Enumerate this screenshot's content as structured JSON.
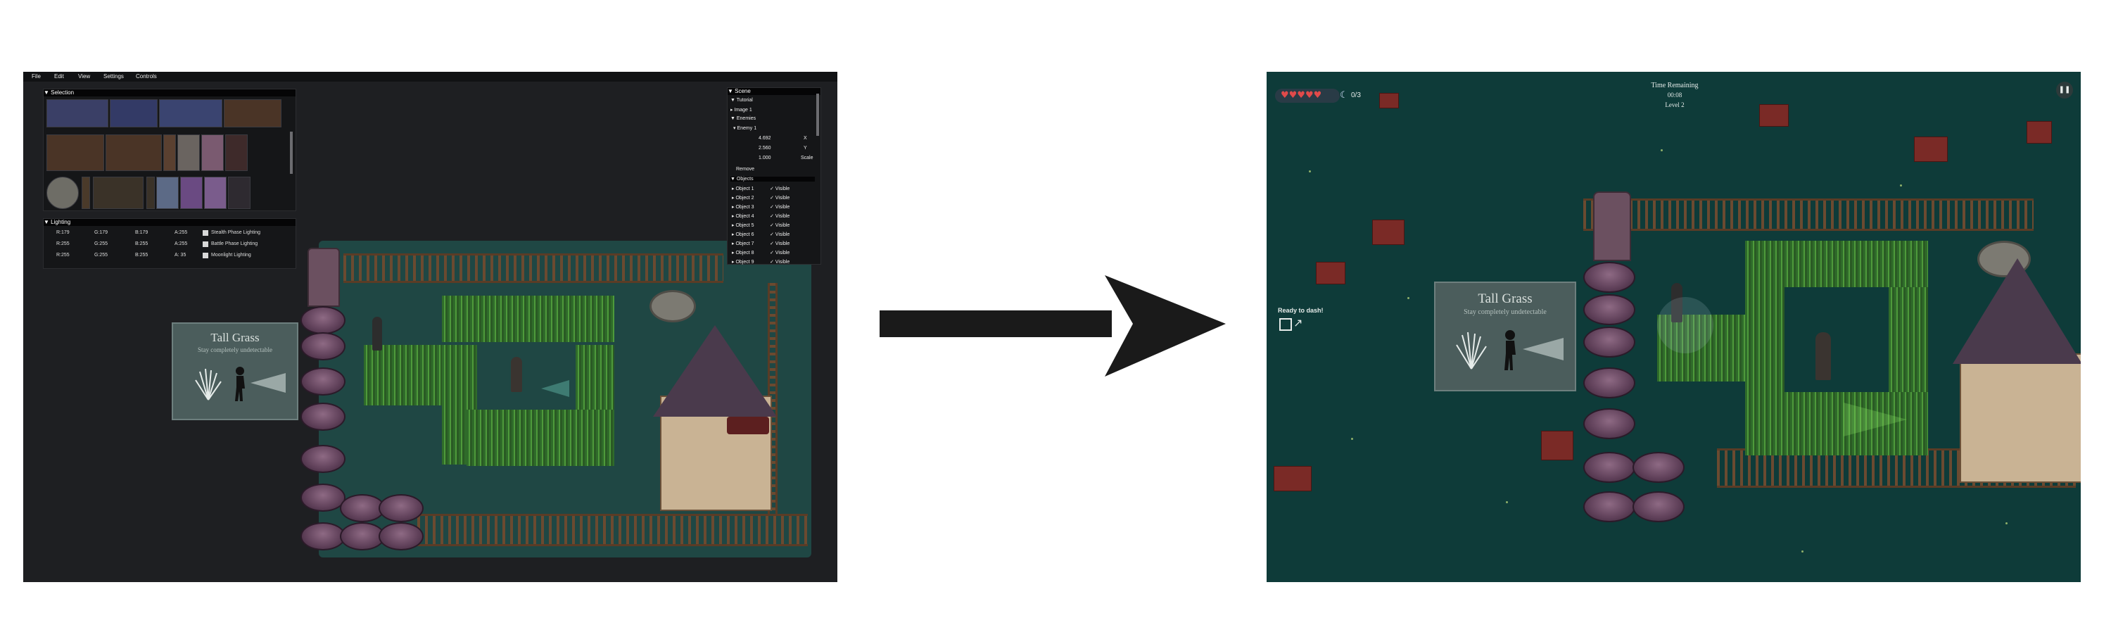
{
  "editor": {
    "menu": [
      "File",
      "Edit",
      "View",
      "Settings",
      "Controls"
    ],
    "selection_header": "▼ Selection",
    "lighting_header": "▼ Lighting",
    "lighting_rows": [
      {
        "r": "R:179",
        "g": "G:179",
        "b": "B:179",
        "a": "A:255",
        "label": "Stealth Phase Lighting"
      },
      {
        "r": "R:255",
        "g": "G:255",
        "b": "B:255",
        "a": "A:255",
        "label": "Battle Phase Lighting"
      },
      {
        "r": "R:255",
        "g": "G:255",
        "b": "B:255",
        "a": "A: 35",
        "label": "Moonlight Lighting"
      }
    ],
    "scene_header": "▼ Scene",
    "scene_items": [
      "▼ Tutorial",
      "▸ Image 1",
      "▼ Enemies",
      "▾ Enemy 1"
    ],
    "transform": [
      {
        "value": "4.692",
        "axis": "X"
      },
      {
        "value": "2.560",
        "axis": "Y"
      },
      {
        "value": "1.000",
        "axis": "Scale"
      }
    ],
    "remove_label": "Remove",
    "objects_header": "▼ Objects",
    "objects": [
      "▸ Object 1",
      "▸ Object 2",
      "▸ Object 3",
      "▸ Object 4",
      "▸ Object 5",
      "▸ Object 6",
      "▸ Object 7",
      "▸ Object 8",
      "▸ Object 9"
    ],
    "visible_label": "✓ Visible",
    "tooltip_title": "Tall Grass",
    "tooltip_sub": "Stay completely undetectable"
  },
  "game": {
    "hearts": "♥♥♥♥♥",
    "moon_counter": "0/3",
    "time_label": "Time Remaining",
    "time_value": "00:08",
    "level_label": "Level 2",
    "pause_icon": "❚❚",
    "dash_label": "Ready to dash!",
    "tooltip_title": "Tall Grass",
    "tooltip_sub": "Stay completely undetectable"
  },
  "colors": {
    "editor_bg": "#1e1f22",
    "game_bg": "#0e3b39",
    "arrow": "#1a1a1a"
  }
}
